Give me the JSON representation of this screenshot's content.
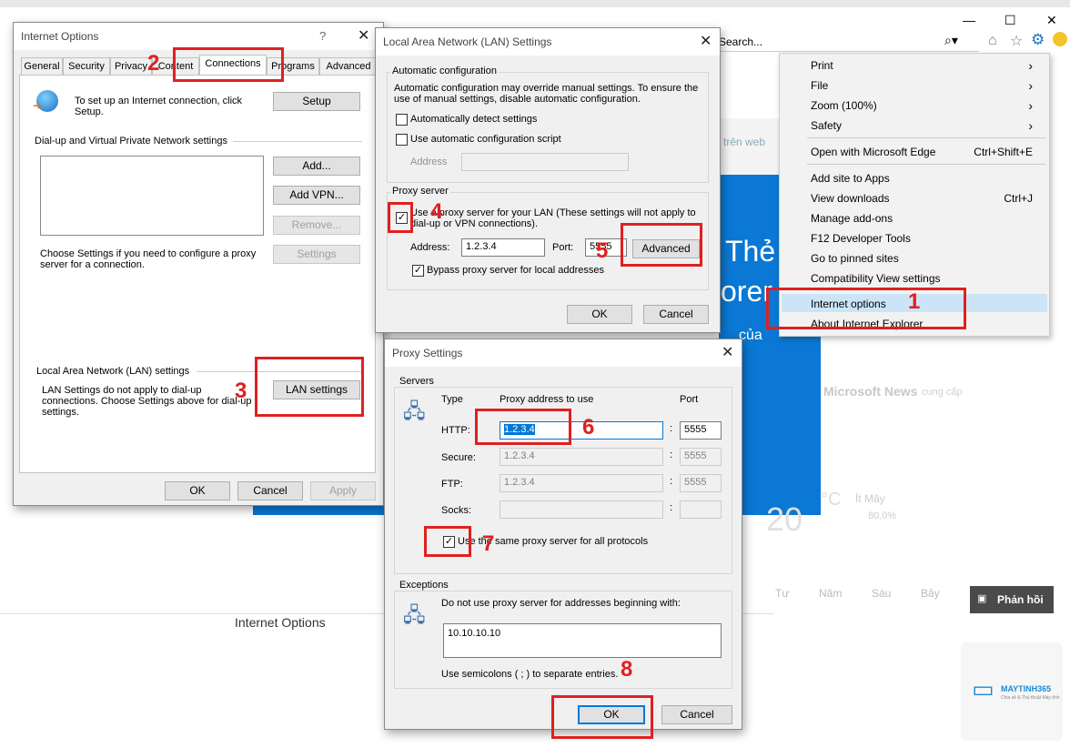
{
  "browser": {
    "search_placeholder": "Search...",
    "window_controls": [
      "—",
      "☐",
      "✕"
    ]
  },
  "background": {
    "link_text": "trên web",
    "big_text_1": "Thẻ",
    "big_text_2": "orer",
    "sub_text": "của",
    "news_text": "Microsoft News",
    "news_suffix": "cung cấp",
    "temp": "20",
    "temp_unit": "°C",
    "weather": "Ít Mây",
    "humidity": "80,0%",
    "days": [
      "Tư",
      "Năm",
      "Sáu",
      "Bảy"
    ],
    "feedback_label": "Phản hồi",
    "bottom_title": "Internet Options",
    "logo_text": "MAYTINH365",
    "logo_sub": "Chia sẻ & Thủ thuật Máy tính"
  },
  "ie_menu": {
    "items": [
      {
        "label": "Print",
        "shortcut": "",
        "arrow": "›"
      },
      {
        "label": "File",
        "shortcut": "",
        "arrow": "›"
      },
      {
        "label": "Zoom (100%)",
        "shortcut": "",
        "arrow": "›"
      },
      {
        "label": "Safety",
        "shortcut": "",
        "arrow": "›"
      },
      {
        "label": "Open with Microsoft Edge",
        "shortcut": "Ctrl+Shift+E",
        "arrow": ""
      },
      {
        "label": "Add site to Apps",
        "shortcut": "",
        "arrow": ""
      },
      {
        "label": "View downloads",
        "shortcut": "Ctrl+J",
        "arrow": ""
      },
      {
        "label": "Manage add-ons",
        "shortcut": "",
        "arrow": ""
      },
      {
        "label": "F12 Developer Tools",
        "shortcut": "",
        "arrow": ""
      },
      {
        "label": "Go to pinned sites",
        "shortcut": "",
        "arrow": ""
      },
      {
        "label": "Compatibility View settings",
        "shortcut": "",
        "arrow": ""
      },
      {
        "label": "Internet options",
        "shortcut": "",
        "arrow": ""
      },
      {
        "label": "About Internet Explorer",
        "shortcut": "",
        "arrow": ""
      }
    ]
  },
  "internet_options": {
    "title": "Internet Options",
    "help": "?",
    "close": "✕",
    "tabs": [
      "General",
      "Security",
      "Privacy",
      "Content",
      "Connections",
      "Programs",
      "Advanced"
    ],
    "setup_text": "To set up an Internet connection, click Setup.",
    "setup_button": "Setup",
    "dialup_header": "Dial-up and Virtual Private Network settings",
    "add_button": "Add...",
    "add_vpn_button": "Add VPN...",
    "remove_button": "Remove...",
    "settings_button": "Settings",
    "choose_text": "Choose Settings if you need to configure a proxy server for a connection.",
    "lan_header": "Local Area Network (LAN) settings",
    "lan_text": "LAN Settings do not apply to dial-up connections. Choose Settings above for dial-up settings.",
    "lan_button": "LAN settings",
    "ok": "OK",
    "cancel": "Cancel",
    "apply": "Apply"
  },
  "lan_dialog": {
    "title": "Local Area Network (LAN) Settings",
    "close": "✕",
    "auto_header": "Automatic configuration",
    "auto_text": "Automatic configuration may override manual settings.  To ensure the use of manual settings, disable automatic configuration.",
    "auto_detect": "Automatically detect settings",
    "auto_script": "Use automatic configuration script",
    "address_label": "Address",
    "proxy_header": "Proxy server",
    "use_proxy": "Use a proxy server for your LAN (These settings will not apply to dial-up or VPN connections).",
    "address_label2": "Address:",
    "address_value": "1.2.3.4",
    "port_label": "Port:",
    "port_value": "5555",
    "advanced_button": "Advanced",
    "bypass": "Bypass proxy server for local addresses",
    "ok": "OK",
    "cancel": "Cancel",
    "check": "✓"
  },
  "proxy_dialog": {
    "title": "Proxy Settings",
    "close": "✕",
    "servers_header": "Servers",
    "col_type": "Type",
    "col_address": "Proxy address to use",
    "col_port": "Port",
    "rows": [
      {
        "type": "HTTP:",
        "address": "1.2.3.4",
        "port": "5555"
      },
      {
        "type": "Secure:",
        "address": "1.2.3.4",
        "port": "5555"
      },
      {
        "type": "FTP:",
        "address": "1.2.3.4",
        "port": "5555"
      },
      {
        "type": "Socks:",
        "address": "",
        "port": ""
      }
    ],
    "colon": ":",
    "same_proxy": "Use the same proxy server for all protocols",
    "exceptions_header": "Exceptions",
    "exceptions_text": "Do not use proxy server for addresses beginning with:",
    "exceptions_value": "10.10.10.10",
    "semicolon_text": "Use semicolons ( ; ) to separate entries.",
    "ok": "OK",
    "cancel": "Cancel"
  },
  "step_numbers": [
    "1",
    "2",
    "3",
    "4",
    "5",
    "6",
    "7",
    "8"
  ],
  "colors": {
    "accent": "#0078d7",
    "annotation": "#e02020",
    "tile": "#0a78d4"
  }
}
